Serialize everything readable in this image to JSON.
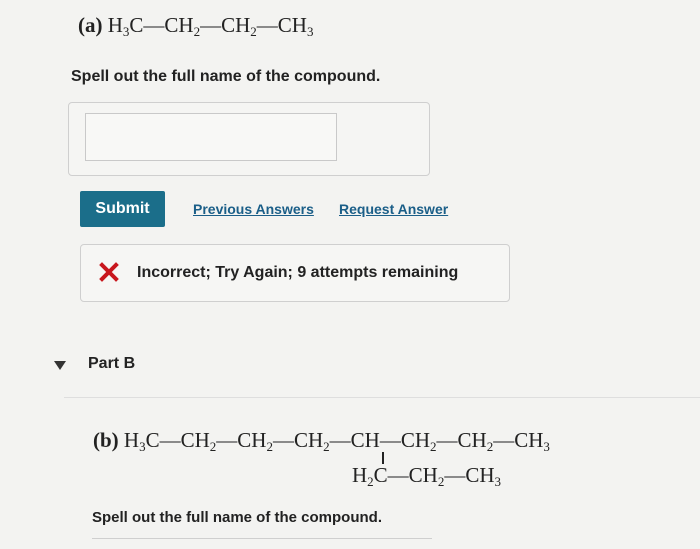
{
  "part_a": {
    "label": "(a)",
    "formula": [
      {
        "t": "H"
      },
      {
        "s": "3"
      },
      {
        "t": "C—CH"
      },
      {
        "s": "2"
      },
      {
        "t": "—CH"
      },
      {
        "s": "2"
      },
      {
        "t": "—CH"
      },
      {
        "s": "3"
      }
    ],
    "prompt": "Spell out the full name of the compound.",
    "input_value": "",
    "submit_label": "Submit",
    "previous_answers_label": "Previous Answers",
    "request_answer_label": "Request Answer",
    "feedback": {
      "icon": "x-icon",
      "color": "#c8161d",
      "text": "Incorrect; Try Again; 9 attempts remaining"
    }
  },
  "part_b": {
    "header": "Part B",
    "label": "(b)",
    "formula_main": [
      {
        "t": "H"
      },
      {
        "s": "3"
      },
      {
        "t": "C—CH"
      },
      {
        "s": "2"
      },
      {
        "t": "—CH"
      },
      {
        "s": "2"
      },
      {
        "t": "—CH"
      },
      {
        "s": "2"
      },
      {
        "t": "—CH—CH"
      },
      {
        "s": "2"
      },
      {
        "t": "—CH"
      },
      {
        "s": "2"
      },
      {
        "t": "—CH"
      },
      {
        "s": "3"
      }
    ],
    "formula_branch": [
      {
        "t": "H"
      },
      {
        "s": "2"
      },
      {
        "t": "C—CH"
      },
      {
        "s": "2"
      },
      {
        "t": "—CH"
      },
      {
        "s": "3"
      }
    ],
    "prompt": "Spell out the full name of the compound."
  },
  "colors": {
    "submit_bg": "#1b6e8a",
    "link": "#1a5e88"
  }
}
